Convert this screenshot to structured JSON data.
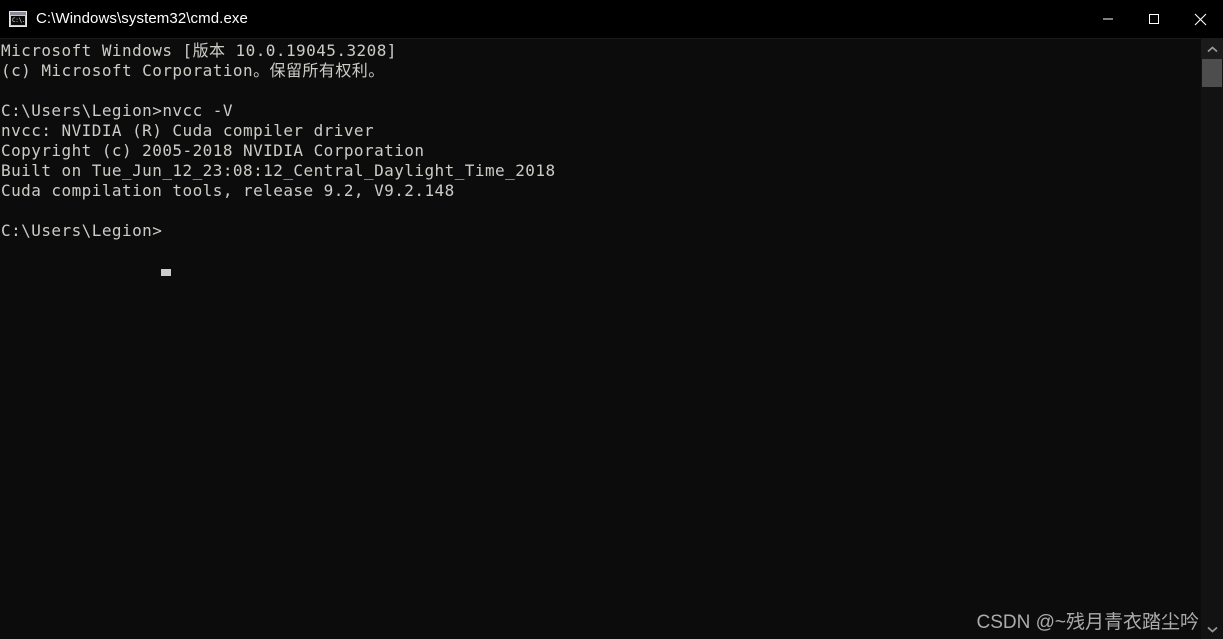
{
  "window": {
    "title": "C:\\Windows\\system32\\cmd.exe",
    "icon_name": "cmd-window-icon",
    "icon_text": "C:\\.",
    "background_color": "#0c0c0c",
    "text_color": "#ccccc7",
    "titlebar_color": "#000000"
  },
  "window_controls": {
    "minimize_label": "Minimize",
    "maximize_label": "Maximize",
    "close_label": "Close"
  },
  "console": {
    "lines": [
      "Microsoft Windows [版本 10.0.19045.3208]",
      "(c) Microsoft Corporation。保留所有权利。",
      "",
      "C:\\Users\\Legion>nvcc -V",
      "nvcc: NVIDIA (R) Cuda compiler driver",
      "Copyright (c) 2005-2018 NVIDIA Corporation",
      "Built on Tue_Jun_12_23:08:12_Central_Daylight_Time_2018",
      "Cuda compilation tools, release 9.2, V9.2.148",
      "",
      "C:\\Users\\Legion>"
    ],
    "prompt": "C:\\Users\\Legion>",
    "command": "nvcc -V",
    "cursor_visible": true
  },
  "scrollbar": {
    "up_arrow_name": "scroll-up-arrow",
    "down_arrow_name": "scroll-down-arrow",
    "thumb_name": "scroll-thumb"
  },
  "watermark": {
    "text": "CSDN @~残月青衣踏尘吟"
  }
}
